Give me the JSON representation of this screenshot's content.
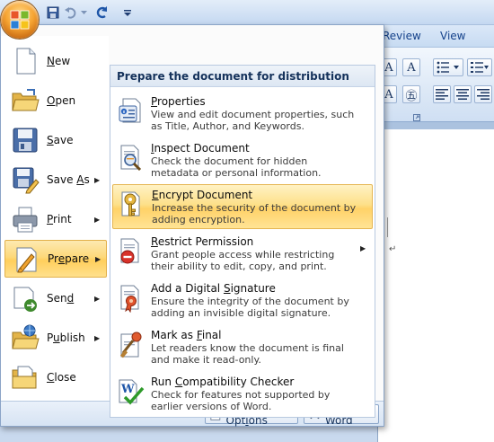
{
  "ribbon": {
    "tabs": [
      "Review",
      "View"
    ]
  },
  "office_menu": {
    "left_items": [
      {
        "label": "New",
        "access_key": "N",
        "rest": "ew",
        "has_arrow": false,
        "icon": "new-document-icon"
      },
      {
        "label": "Open",
        "access_key": "O",
        "rest": "pen",
        "has_arrow": false,
        "icon": "open-folder-icon"
      },
      {
        "label": "Save",
        "access_key": "S",
        "rest": "ave",
        "has_arrow": false,
        "icon": "save-disk-icon"
      },
      {
        "label": "Save As",
        "pre": "Save ",
        "access_key": "A",
        "rest": "s",
        "has_arrow": true,
        "icon": "save-as-icon"
      },
      {
        "label": "Print",
        "access_key": "P",
        "rest": "rint",
        "has_arrow": true,
        "icon": "printer-icon"
      },
      {
        "label": "Prepare",
        "access_key": "E",
        "pre": "Pr",
        "rest": "pare",
        "has_arrow": true,
        "active": true,
        "icon": "prepare-icon"
      },
      {
        "label": "Send",
        "access_key": "d",
        "pre": "Sen",
        "rest": "",
        "has_arrow": true,
        "icon": "send-icon"
      },
      {
        "label": "Publish",
        "access_key": "u",
        "pre": "P",
        "rest": "blish",
        "has_arrow": true,
        "icon": "publish-icon"
      },
      {
        "label": "Close",
        "access_key": "C",
        "rest": "lose",
        "has_arrow": false,
        "icon": "close-folder-icon"
      }
    ],
    "submenu": {
      "header": "Prepare the document for distribution",
      "items": [
        {
          "title": "Properties",
          "access_key": "P",
          "rest": "roperties",
          "description": "View and edit document properties, such as Title, Author, and Keywords.",
          "icon": "properties-icon"
        },
        {
          "title": "Inspect Document",
          "access_key": "I",
          "rest": "nspect Document",
          "description": "Check the document for hidden metadata or personal information.",
          "icon": "inspect-document-icon"
        },
        {
          "title": "Encrypt Document",
          "access_key": "E",
          "rest": "ncrypt Document",
          "description": "Increase the security of the document by adding encryption.",
          "active": true,
          "icon": "encrypt-key-icon"
        },
        {
          "title": "Restrict Permission",
          "access_key": "R",
          "rest": "estrict Permission",
          "description": "Grant people access while restricting their ability to edit, copy, and print.",
          "has_arrow": true,
          "icon": "restrict-permission-icon"
        },
        {
          "title": "Add a Digital Signature",
          "pre": "Add a Digital ",
          "access_key": "S",
          "rest": "ignature",
          "description": "Ensure the integrity of the document by adding an invisible digital signature.",
          "icon": "digital-signature-icon"
        },
        {
          "title": "Mark as Final",
          "pre": "Mark as ",
          "access_key": "F",
          "rest": "inal",
          "description": "Let readers know the document is final and make it read-only.",
          "icon": "mark-final-icon"
        },
        {
          "title": "Run Compatibility Checker",
          "pre": "Run ",
          "access_key": "C",
          "rest": "ompatibility Checker",
          "description": "Check for features not supported by earlier versions of Word.",
          "icon": "compatibility-checker-icon"
        }
      ]
    },
    "bottom_buttons": [
      {
        "label": "Word Options",
        "pre": "Word Opt",
        "access_key": "i",
        "rest": "ons",
        "icon": "word-options-icon"
      },
      {
        "label": "Exit Word",
        "pre": "E",
        "access_key": "x",
        "rest": "it Word",
        "icon": "exit-x-icon"
      }
    ]
  }
}
